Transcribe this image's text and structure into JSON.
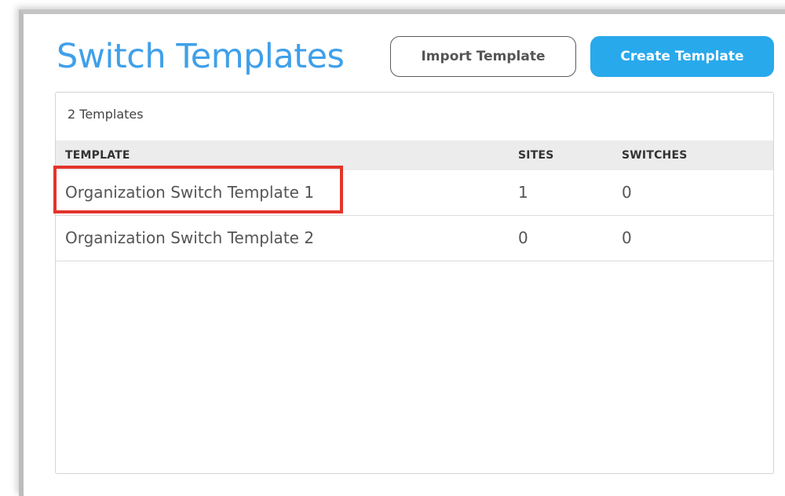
{
  "page": {
    "title": "Switch Templates"
  },
  "toolbar": {
    "import_label": "Import Template",
    "create_label": "Create Template"
  },
  "templates_panel": {
    "count_label": "2 Templates",
    "columns": {
      "template": "TEMPLATE",
      "sites": "SITES",
      "switches": "SWITCHES"
    },
    "rows": [
      {
        "name": "Organization Switch Template 1",
        "sites": "1",
        "switches": "0"
      },
      {
        "name": "Organization Switch Template 2",
        "sites": "0",
        "switches": "0"
      }
    ]
  },
  "colors": {
    "title": "#3fa0e9",
    "create_button": "#28a9ec",
    "highlight": "#e2352b",
    "header_background": "#ececec"
  }
}
